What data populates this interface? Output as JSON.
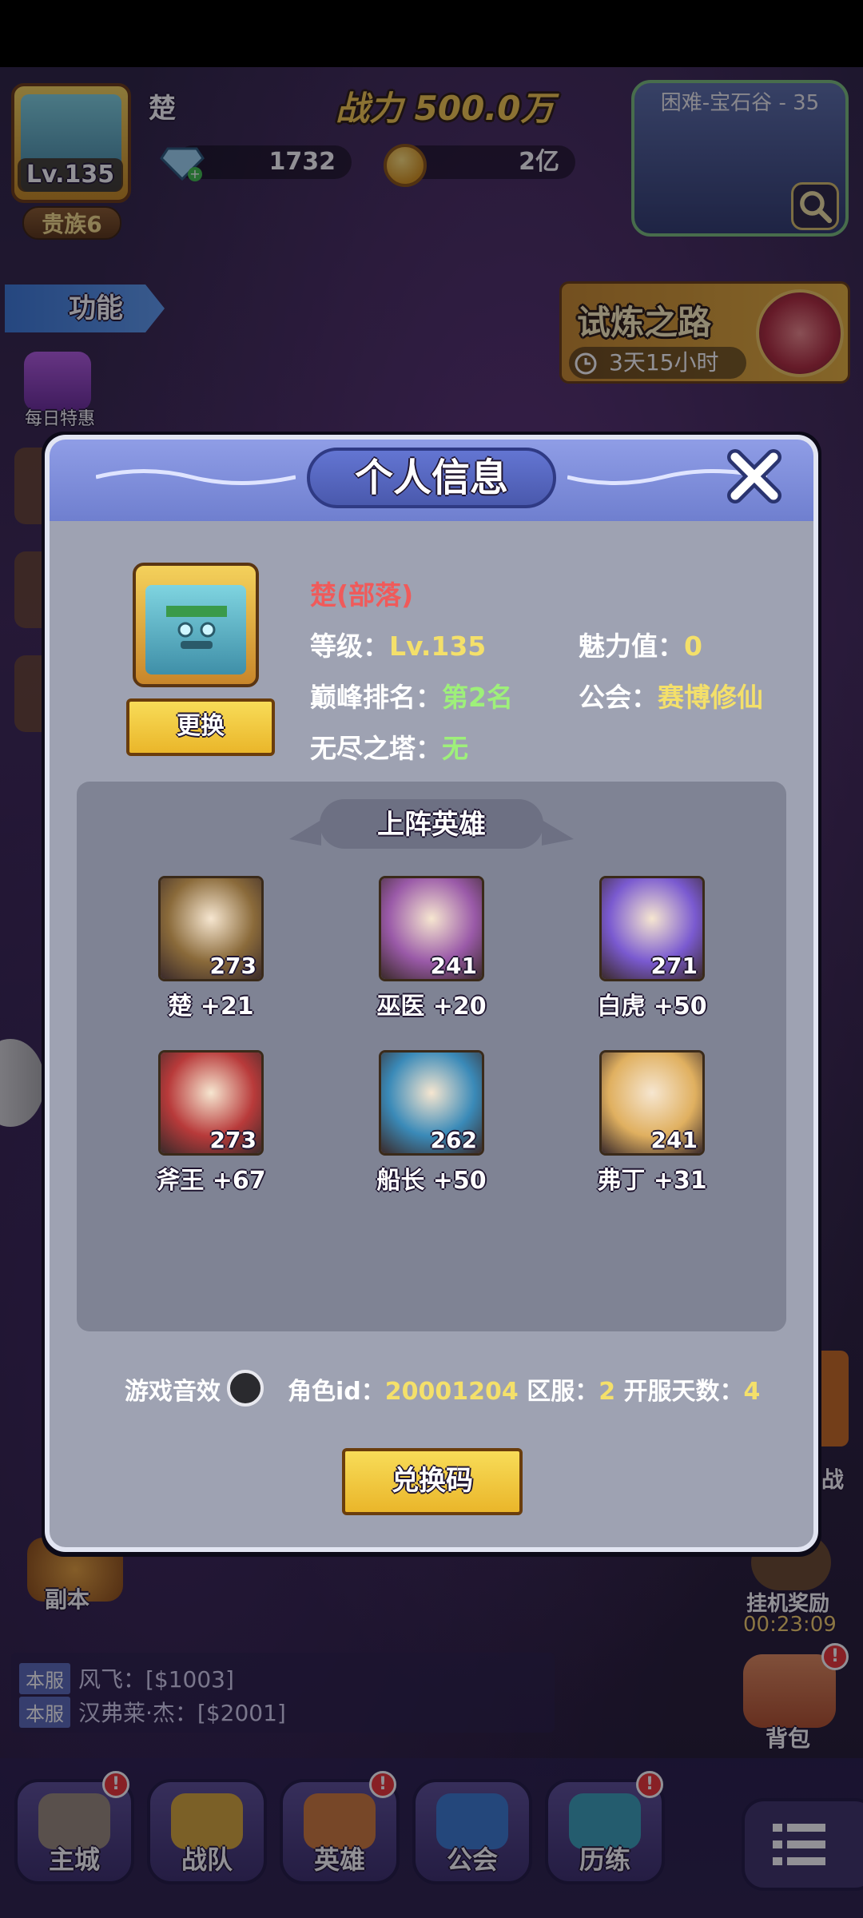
{
  "hud": {
    "player_name": "楚",
    "level": "Lv.135",
    "noble": "贵族6",
    "power_label": "战力",
    "power_value": "500.0万",
    "gems": "1732",
    "gold": "2亿",
    "map_title": "困难-宝石谷 - 35"
  },
  "side": {
    "functions_label": "功能",
    "daily_label": "每日特惠",
    "trial_title": "试炼之路",
    "trial_time": "3天15小时",
    "dungeon_label": "副本",
    "afk_label": "挂机奖励",
    "afk_time": "00:23:09",
    "bag_label": "背包",
    "battle_label": "战"
  },
  "chat": [
    {
      "tag": "本服",
      "text": "风飞：[$1003]"
    },
    {
      "tag": "本服",
      "text": "汉弗莱·杰：[$2001]"
    }
  ],
  "nav": {
    "items": [
      {
        "label": "主城",
        "badge": "!"
      },
      {
        "label": "战队",
        "badge": ""
      },
      {
        "label": "英雄",
        "badge": "!"
      },
      {
        "label": "公会",
        "badge": ""
      },
      {
        "label": "历练",
        "badge": "!"
      }
    ]
  },
  "modal": {
    "title": "个人信息",
    "change_button": "更换",
    "name": "楚(部落)",
    "level_label": "等级：",
    "level_value": "Lv.135",
    "charm_label": "魅力值：",
    "charm_value": "0",
    "rank_label": "巅峰排名：",
    "rank_value": "第2名",
    "guild_label": "公会：",
    "guild_value": "赛博修仙",
    "tower_label": "无尽之塔：",
    "tower_value": "无",
    "heroes_title": "上阵英雄",
    "heroes": [
      {
        "level": "273",
        "name": "楚 +21",
        "color": "#8a6a3a"
      },
      {
        "level": "241",
        "name": "巫医 +20",
        "color": "#9a5aa8"
      },
      {
        "level": "271",
        "name": "白虎 +50",
        "color": "#7a5ad0"
      },
      {
        "level": "273",
        "name": "斧王 +67",
        "color": "#b83a3a"
      },
      {
        "level": "262",
        "name": "船长 +50",
        "color": "#3a8ab8"
      },
      {
        "level": "241",
        "name": "弗丁 +31",
        "color": "#e0b060"
      }
    ],
    "sound_label": "游戏音效",
    "role_id_label": "角色id：",
    "role_id_value": "20001204",
    "server_label": "区服：",
    "server_value": "2",
    "open_days_label": "开服天数：",
    "open_days_value": "4",
    "exchange_button": "兑换码"
  }
}
